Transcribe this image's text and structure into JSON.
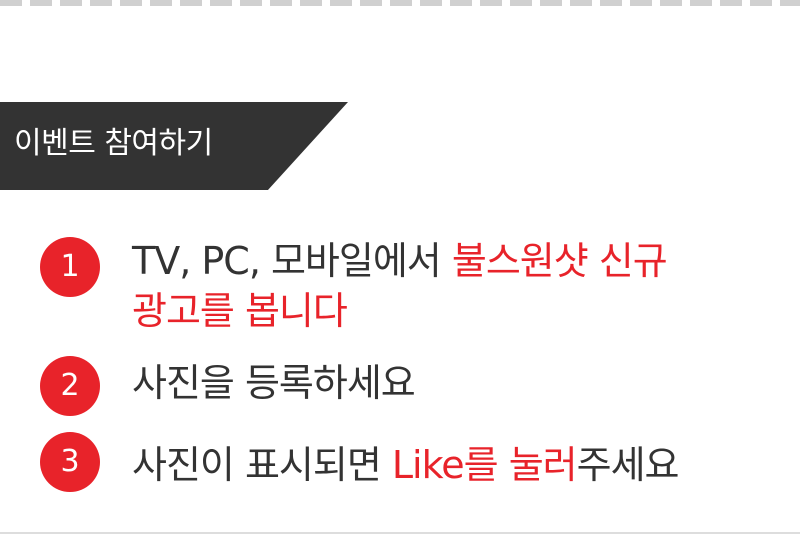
{
  "banner": {
    "title": "이벤트 참여하기"
  },
  "steps": [
    {
      "number": "1",
      "line1_prefix": "TV, PC, 모바일에서 ",
      "line1_highlight": "불스원샷 신규",
      "line2_highlight": "광고를 봅니다"
    },
    {
      "number": "2",
      "text": "사진을 등록하세요"
    },
    {
      "number": "3",
      "prefix": "사진이 표시되면 ",
      "highlight": "Like를 눌러",
      "suffix": "주세요"
    }
  ],
  "colors": {
    "accent": "#e8232a",
    "banner_bg": "#333333",
    "text": "#333333"
  }
}
